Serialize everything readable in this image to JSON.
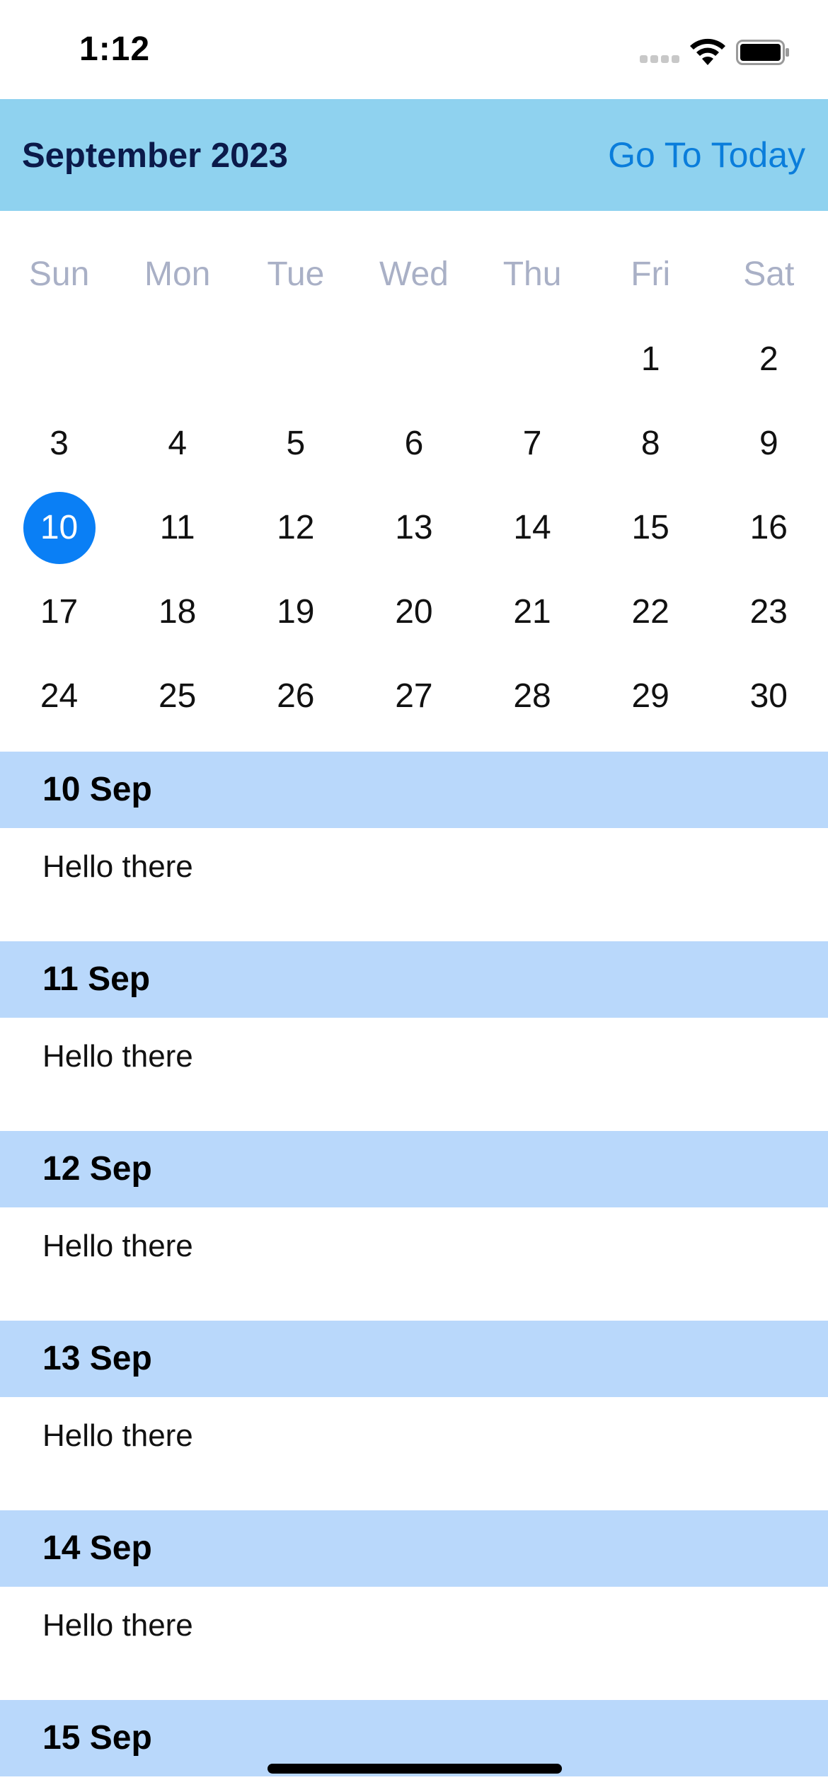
{
  "status_bar": {
    "time": "1:12",
    "icons": [
      "cellular-signal-icon",
      "wifi-icon",
      "battery-icon"
    ]
  },
  "header": {
    "title": "September 2023",
    "go_to_today_label": "Go To Today"
  },
  "calendar": {
    "weekdays": [
      "Sun",
      "Mon",
      "Tue",
      "Wed",
      "Thu",
      "Fri",
      "Sat"
    ],
    "leading_blank_days": 5,
    "days": [
      "1",
      "2",
      "3",
      "4",
      "5",
      "6",
      "7",
      "8",
      "9",
      "10",
      "11",
      "12",
      "13",
      "14",
      "15",
      "16",
      "17",
      "18",
      "19",
      "20",
      "21",
      "22",
      "23",
      "24",
      "25",
      "26",
      "27",
      "28",
      "29",
      "30"
    ],
    "selected_day": "10"
  },
  "agenda": {
    "sections": [
      {
        "date": "10 Sep",
        "items": [
          "Hello there"
        ]
      },
      {
        "date": "11 Sep",
        "items": [
          "Hello there"
        ]
      },
      {
        "date": "12 Sep",
        "items": [
          "Hello there"
        ]
      },
      {
        "date": "13 Sep",
        "items": [
          "Hello there"
        ]
      },
      {
        "date": "14 Sep",
        "items": [
          "Hello there"
        ]
      },
      {
        "date": "15 Sep",
        "items": []
      }
    ]
  },
  "colors": {
    "header_bg": "#8fd2ef",
    "title_color": "#0b1a4a",
    "link_color": "#0a7ddb",
    "selected_day_bg": "#0a7ff5",
    "weekday_color": "#a9b0c6",
    "section_header_bg": "#b9d8fb"
  }
}
